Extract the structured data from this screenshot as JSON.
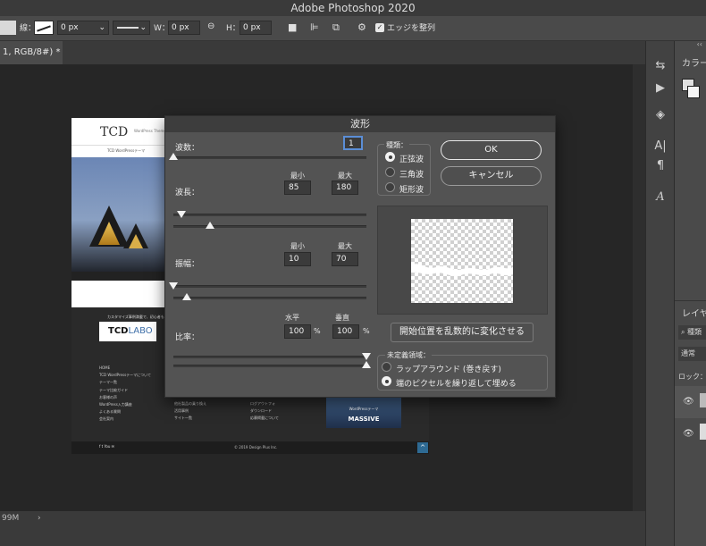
{
  "app": {
    "title": "Adobe Photoshop 2020"
  },
  "options_bar": {
    "stroke_label": "線：",
    "width_value": "0 px",
    "w_label": "W：",
    "w_value": "0 px",
    "h_label": "H：",
    "h_value": "0 px",
    "align_edges_label": "エッジを整列",
    "align_edges_checked": true
  },
  "document": {
    "tab_label": "1, RGB/8#) *",
    "status_zoom": "99M",
    "status_arrow": "›"
  },
  "right_panel": {
    "color_tab": "カラー",
    "layers_tab": "レイヤ",
    "kind_label": "種類",
    "blend_mode": "通常",
    "lock_label": "ロック：",
    "collapse_icon": "‹‹"
  },
  "webpage": {
    "logo": "TCD",
    "logo_sub": "WordPress Theme",
    "tagline": "TCD WordPressテーマ",
    "labo_caption": "カスタマイズ事例満載で、初心者も",
    "labo_prefix": "TCD",
    "labo_suffix": "LABO",
    "footer_col1": [
      "HOME",
      "TCD WordPressテーマについて",
      "テーマ一覧",
      "テーマ比較ガイド",
      "お客様の声",
      "WordPress入力講座",
      "よくある質問",
      "会社案内"
    ],
    "footer_col2": [
      "他社製品の乗り換え",
      "活用事例",
      "サイト一覧"
    ],
    "footer_col3": [
      "ログアウトフォ",
      "ダウンロード",
      "応募掲載について"
    ],
    "banner_sub": "WordPressテーマ",
    "banner_title": "MASSIVE",
    "social": "f  t  You  ✉",
    "copyright": "© 2019 Design Plus Inc.",
    "up_arrow": "^"
  },
  "dialog": {
    "title": "波形",
    "generators_label": "波数：",
    "generators_value": "1",
    "wavelength_label": "波長：",
    "wavelength_min_label": "最小",
    "wavelength_max_label": "最大",
    "wavelength_min": "85",
    "wavelength_max": "180",
    "amplitude_label": "振幅：",
    "amplitude_min_label": "最小",
    "amplitude_max_label": "最大",
    "amplitude_min": "10",
    "amplitude_max": "70",
    "scale_label": "比率：",
    "scale_h_label": "水平",
    "scale_v_label": "垂直",
    "scale_h": "100",
    "scale_v": "100",
    "percent": "%",
    "type_label": "種類：",
    "types": [
      "正弦波",
      "三角波",
      "矩形波"
    ],
    "type_selected": "正弦波",
    "ok_label": "OK",
    "cancel_label": "キャンセル",
    "randomize_label": "開始位置を乱数的に変化させる",
    "undefined_label": "未定義領域：",
    "undefined_options": [
      "ラップアラウンド (巻き戻す)",
      "端のピクセルを繰り返して埋める"
    ],
    "undefined_selected": "端のピクセルを繰り返して埋める",
    "slider_levels": {
      "generators": 0.0,
      "wavelength_min": 0.04,
      "wavelength_max": 0.19,
      "amplitude_min": 0.0,
      "amplitude_max": 0.07,
      "scale_h": 1.0,
      "scale_v": 1.0
    }
  }
}
